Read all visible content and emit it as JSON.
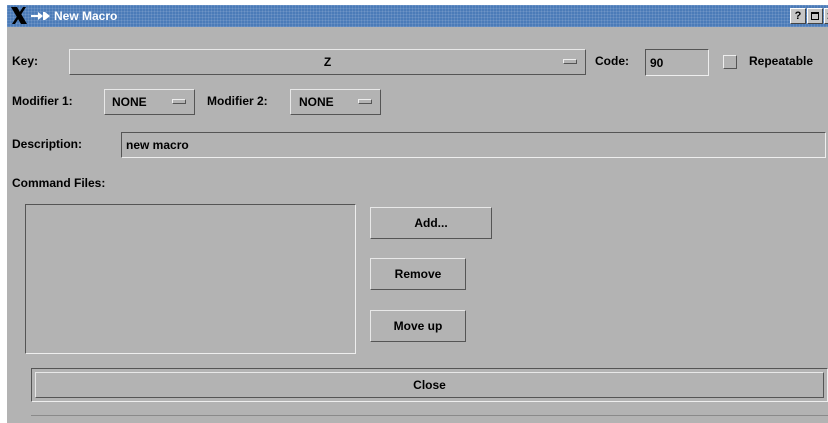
{
  "window": {
    "title": "New Macro",
    "help_label": "?",
    "accent_color": "#4b7bb8",
    "background_color": "#b3b3b3"
  },
  "key_row": {
    "key_label": "Key:",
    "key_value": "Z",
    "code_label": "Code:",
    "code_value": "90",
    "repeatable_label": "Repeatable",
    "repeatable_checked": false
  },
  "modifier_row": {
    "modifier1_label": "Modifier 1:",
    "modifier1_value": "NONE",
    "modifier2_label": "Modifier 2:",
    "modifier2_value": "NONE"
  },
  "description": {
    "label": "Description:",
    "value": "new macro"
  },
  "command_files": {
    "label": "Command Files:",
    "items": [],
    "add_label": "Add...",
    "remove_label": "Remove",
    "move_up_label": "Move up"
  },
  "close_label": "Close"
}
